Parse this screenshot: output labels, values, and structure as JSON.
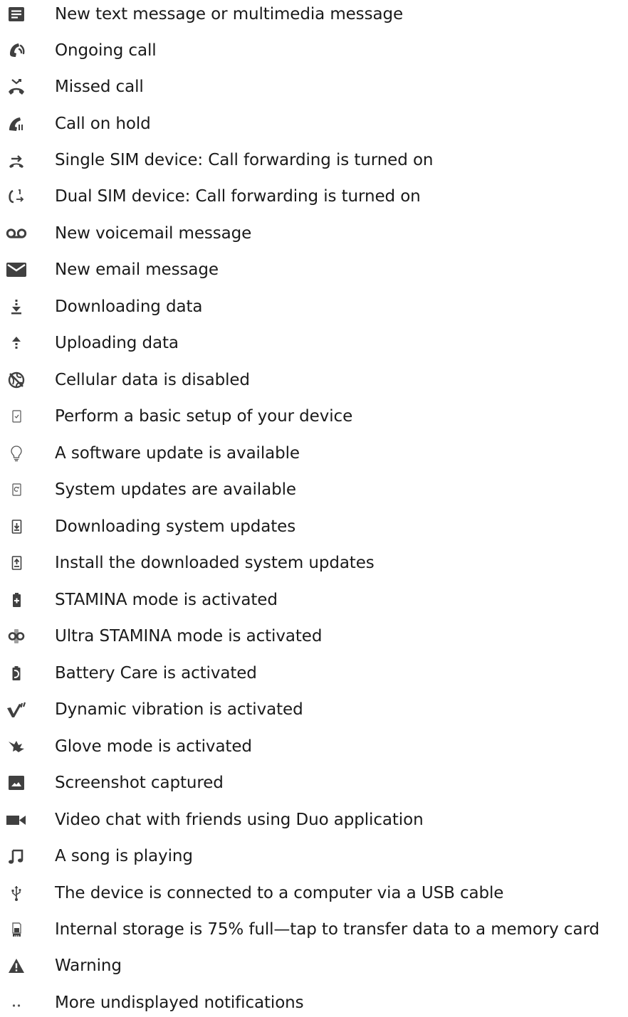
{
  "icon_color": "#404040",
  "text_color": "#1a1a1a",
  "items": [
    {
      "icon": "message-icon",
      "label": "New text message or multimedia message"
    },
    {
      "icon": "ongoing-call-icon",
      "label": "Ongoing call"
    },
    {
      "icon": "missed-call-icon",
      "label": "Missed call"
    },
    {
      "icon": "call-on-hold-icon",
      "label": "Call on hold"
    },
    {
      "icon": "call-forwarding-icon",
      "label": "Single SIM device: Call forwarding is turned on"
    },
    {
      "icon": "dual-sim-call-forwarding-icon",
      "label": "Dual SIM device: Call forwarding is turned on"
    },
    {
      "icon": "voicemail-icon",
      "label": "New voicemail message"
    },
    {
      "icon": "email-icon",
      "label": "New email message"
    },
    {
      "icon": "download-icon",
      "label": "Downloading data"
    },
    {
      "icon": "upload-icon",
      "label": "Uploading data"
    },
    {
      "icon": "cellular-data-disabled-icon",
      "label": "Cellular data is disabled"
    },
    {
      "icon": "device-setup-icon",
      "label": "Perform a basic setup of your device"
    },
    {
      "icon": "lightbulb-icon",
      "label": "A software update is available"
    },
    {
      "icon": "system-update-icon",
      "label": "System updates are available"
    },
    {
      "icon": "downloading-system-update-icon",
      "label": "Downloading system updates"
    },
    {
      "icon": "install-system-update-icon",
      "label": "Install the downloaded system updates"
    },
    {
      "icon": "stamina-mode-icon",
      "label": "STAMINA mode is activated"
    },
    {
      "icon": "ultra-stamina-mode-icon",
      "label": "Ultra STAMINA mode is activated"
    },
    {
      "icon": "battery-care-icon",
      "label": "Battery Care is activated"
    },
    {
      "icon": "dynamic-vibration-icon",
      "label": "Dynamic vibration is activated"
    },
    {
      "icon": "glove-mode-icon",
      "label": "Glove mode is activated"
    },
    {
      "icon": "screenshot-icon",
      "label": "Screenshot captured"
    },
    {
      "icon": "video-chat-icon",
      "label": "Video chat with friends using Duo application"
    },
    {
      "icon": "music-note-icon",
      "label": "A song is playing"
    },
    {
      "icon": "usb-icon",
      "label": "The device is connected to a computer via a USB cable"
    },
    {
      "icon": "internal-storage-icon",
      "label": "Internal storage is 75% full—tap to transfer data to a memory card"
    },
    {
      "icon": "warning-icon",
      "label": "Warning"
    },
    {
      "icon": "more-notifications-icon",
      "label": "More undisplayed notifications"
    }
  ]
}
